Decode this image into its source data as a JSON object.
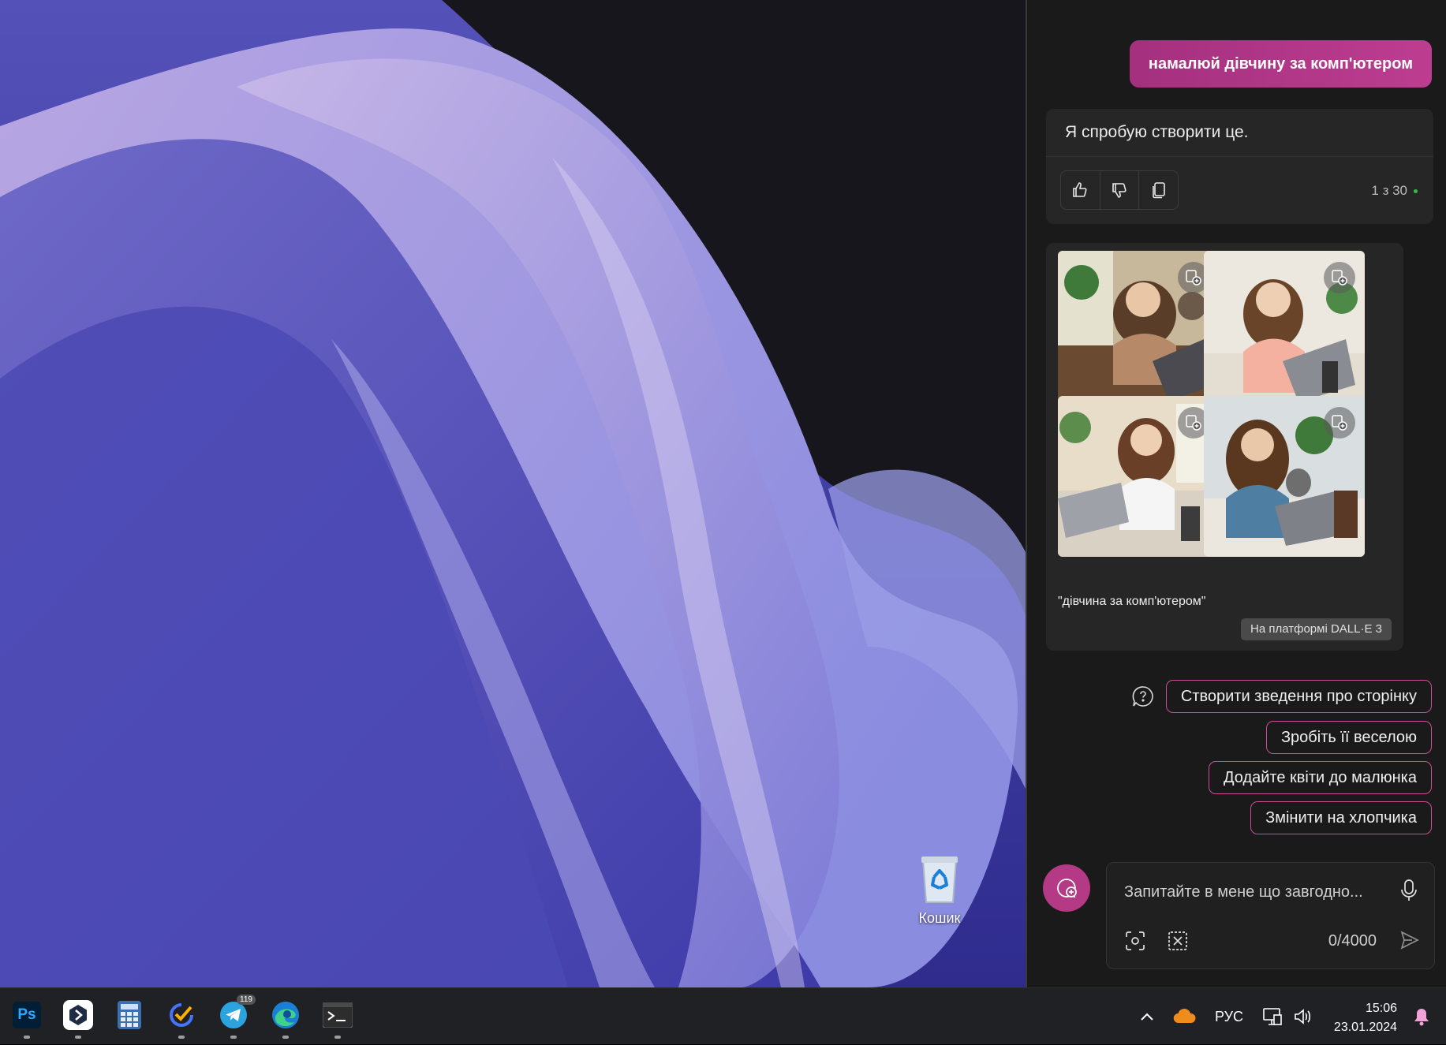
{
  "desktop": {
    "recycle_bin_label": "Кошик"
  },
  "copilot": {
    "user_message": "намалюй дівчину за комп'ютером",
    "reply_text": "Я спробую створити це.",
    "response_counter": "1 з 30",
    "image_prompt": "\"дівчина за комп'ютером\"",
    "platform_badge": "На платформі DALL·E 3",
    "suggestions": [
      "Створити зведення про сторінку",
      "Зробіть її веселою",
      "Додайте квіти до малюнка",
      "Змінити на хлопчика"
    ],
    "composer": {
      "placeholder": "Запитайте в мене що завгодно...",
      "char_count": "0/4000"
    }
  },
  "taskbar": {
    "apps": [
      {
        "name": "photoshop",
        "label": "Ps"
      },
      {
        "name": "app-launcher",
        "label": ""
      },
      {
        "name": "calculator",
        "label": ""
      },
      {
        "name": "ticktick",
        "label": ""
      },
      {
        "name": "telegram",
        "label": "",
        "badge": "119"
      },
      {
        "name": "edge",
        "label": ""
      },
      {
        "name": "terminal",
        "label": ""
      }
    ],
    "language": "РУС",
    "time": "15:06",
    "date": "23.01.2024"
  },
  "colors": {
    "accent_pink": "#bd3d91",
    "panel_bg": "#1a1a1a",
    "card_bg": "#262626",
    "taskbar_bg": "#202124"
  }
}
